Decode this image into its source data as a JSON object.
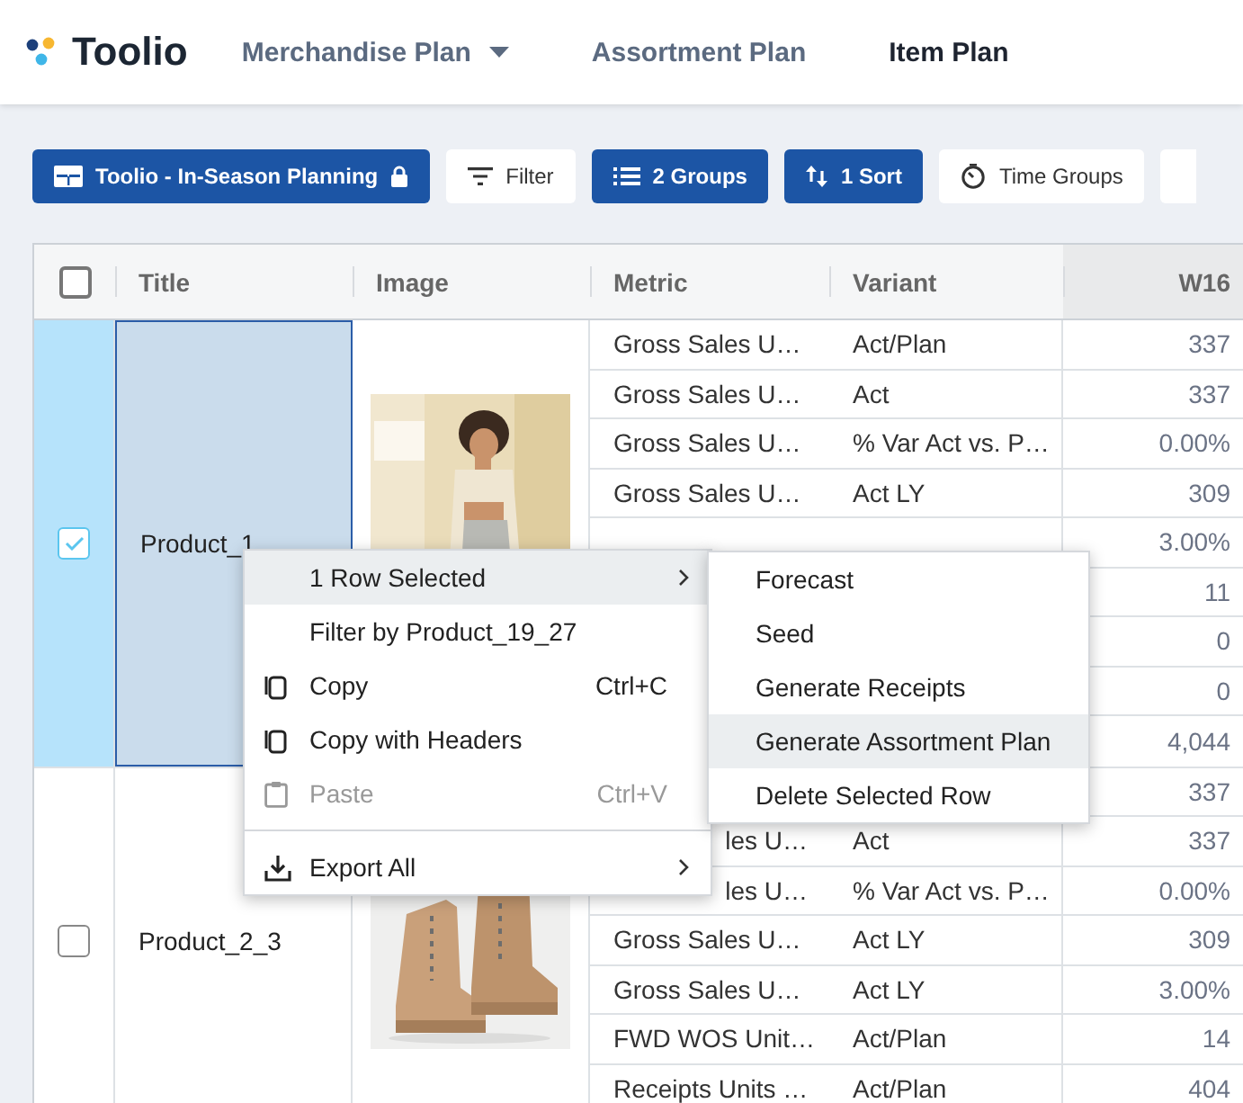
{
  "logo": "Toolio",
  "nav": [
    {
      "label": "Merchandise Plan",
      "dropdown": true,
      "selected": false
    },
    {
      "label": "Assortment Plan",
      "dropdown": false,
      "selected": false
    },
    {
      "label": "Item Plan",
      "dropdown": false,
      "selected": true
    }
  ],
  "toolbar": [
    {
      "label": "Toolio - In-Season Planning",
      "kind": "table",
      "primary": true,
      "locked": true
    },
    {
      "label": "Filter",
      "kind": "filter",
      "primary": false,
      "locked": false
    },
    {
      "label": "2 Groups",
      "kind": "list",
      "primary": true,
      "locked": false
    },
    {
      "label": "1 Sort",
      "kind": "sort",
      "primary": true,
      "locked": false
    },
    {
      "label": "Time Groups",
      "kind": "timer",
      "primary": false,
      "locked": false
    }
  ],
  "table": {
    "select_all_checked": false,
    "columns": [
      {
        "label": "Title",
        "highlighted": false
      },
      {
        "label": "Image",
        "highlighted": false
      },
      {
        "label": "Metric",
        "highlighted": false
      },
      {
        "label": "Variant",
        "highlighted": false
      },
      {
        "label": "W16",
        "highlighted": true
      }
    ],
    "groups": [
      {
        "title": "Product_1",
        "selected": true,
        "rows": [
          {
            "metric": "Gross Sales U…",
            "variant": "Act/Plan",
            "value": "337"
          },
          {
            "metric": "Gross Sales U…",
            "variant": "Act",
            "value": "337"
          },
          {
            "metric": "Gross Sales U…",
            "variant": "% Var Act vs. P…",
            "value": "0.00%"
          },
          {
            "metric": "Gross Sales U…",
            "variant": "Act LY",
            "value": "309"
          },
          {
            "value": "3.00%"
          },
          {
            "value": "11"
          },
          {
            "value": "0"
          },
          {
            "value": "0"
          },
          {
            "value": "4,044"
          }
        ]
      },
      {
        "title": "Product_2_3",
        "selected": false,
        "rows": [
          {
            "value": "337"
          },
          {
            "metric": "les U…",
            "metric_cut": true,
            "variant": "Act",
            "value": "337"
          },
          {
            "metric": "les U…",
            "metric_cut": true,
            "variant": "% Var Act vs. P…",
            "value": "0.00%"
          },
          {
            "metric": "Gross Sales U…",
            "variant": "Act LY",
            "value": "309"
          },
          {
            "metric": "Gross Sales U…",
            "variant": "Act LY",
            "value": "3.00%"
          },
          {
            "metric": "FWD WOS Unit…",
            "variant": "Act/Plan",
            "value": "14"
          },
          {
            "metric": "Receipts Units …",
            "variant": "Act/Plan",
            "value": "404"
          }
        ]
      }
    ]
  },
  "context_menu": {
    "items": [
      {
        "kind": "item",
        "label": "1 Row Selected",
        "submenu": true,
        "highlighted": true,
        "disabled": false
      },
      {
        "kind": "item",
        "label": "Filter by Product_19_27",
        "submenu": false,
        "highlighted": false,
        "disabled": false
      },
      {
        "kind": "copy",
        "label": "Copy",
        "shortcut": "Ctrl+C",
        "submenu": false,
        "highlighted": false,
        "disabled": false
      },
      {
        "kind": "copy",
        "label": "Copy with Headers",
        "submenu": false,
        "highlighted": false,
        "disabled": false
      },
      {
        "kind": "paste",
        "label": "Paste",
        "shortcut": "Ctrl+V",
        "submenu": false,
        "highlighted": false,
        "disabled": true
      },
      {
        "kind": "divider"
      },
      {
        "kind": "export",
        "label": "Export All",
        "submenu": true,
        "highlighted": false,
        "disabled": false
      }
    ]
  },
  "submenu": {
    "items": [
      {
        "label": "Forecast",
        "highlighted": false
      },
      {
        "label": "Seed",
        "highlighted": false
      },
      {
        "label": "Generate Receipts",
        "highlighted": false
      },
      {
        "label": "Generate Assortment Plan",
        "highlighted": true
      },
      {
        "label": "Delete Selected Row",
        "highlighted": false
      }
    ]
  }
}
